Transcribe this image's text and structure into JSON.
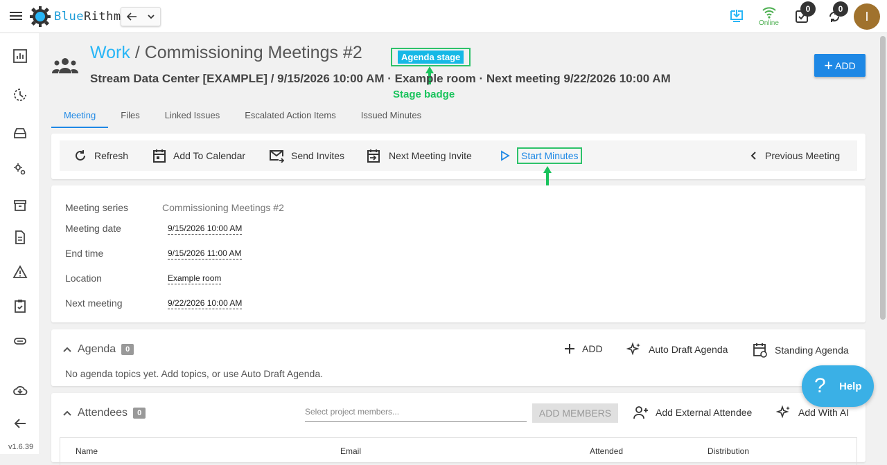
{
  "app": {
    "logo_part1": "Blue",
    "logo_part2": "Rithm",
    "version": "v1.6.39"
  },
  "header": {
    "online_label": "Online",
    "tasks_count": "0",
    "sync_count": "0",
    "avatar_initial": "I"
  },
  "page": {
    "breadcrumb_root": "Work",
    "breadcrumb_sep": " / ",
    "title": "Commissioning Meetings #2",
    "stage": "Agenda stage",
    "stage_annotation": "Stage badge",
    "subtitle": "Stream Data Center [EXAMPLE] / 9/15/2026 10:00 AM · Example room · Next meeting 9/22/2026 10:00 AM",
    "add_label": "ADD"
  },
  "tabs": [
    {
      "label": "Meeting"
    },
    {
      "label": "Files"
    },
    {
      "label": "Linked Issues"
    },
    {
      "label": "Escalated Action Items"
    },
    {
      "label": "Issued Minutes"
    }
  ],
  "toolbar": {
    "refresh": "Refresh",
    "add_to_calendar": "Add To Calendar",
    "send_invites": "Send Invites",
    "next_meeting_invite": "Next Meeting Invite",
    "start_minutes": "Start Minutes",
    "previous_meeting": "Previous Meeting"
  },
  "details": {
    "series_label": "Meeting series",
    "series_value": "Commissioning Meetings #2",
    "date_label": "Meeting date",
    "date_value": "9/15/2026 10:00 AM",
    "end_label": "End time",
    "end_value": "9/15/2026 11:00 AM",
    "location_label": "Location",
    "location_value": "Example room",
    "next_label": "Next meeting",
    "next_value": "9/22/2026 10:00 AM"
  },
  "agenda": {
    "title": "Agenda",
    "count": "0",
    "add": "ADD",
    "auto_draft": "Auto Draft Agenda",
    "standing": "Standing Agenda",
    "empty": "No agenda topics yet. Add topics, or use Auto Draft Agenda."
  },
  "attendees": {
    "title": "Attendees",
    "count": "0",
    "placeholder": "Select project members...",
    "add_members": "ADD MEMBERS",
    "add_external": "Add External Attendee",
    "add_ai": "Add With AI",
    "columns": [
      "Name",
      "Email",
      "Attended",
      "Distribution"
    ]
  },
  "help": {
    "label": "Help"
  }
}
